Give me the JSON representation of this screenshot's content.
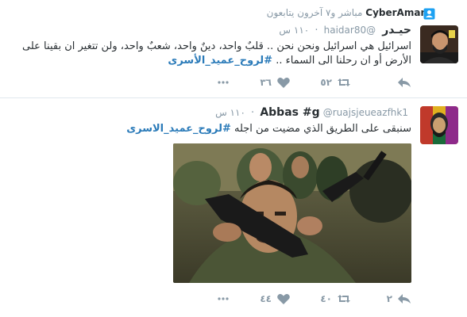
{
  "tweets": [
    {
      "context": {
        "user": "CyberAman",
        "text": "مباشر و٧ آخرون يتابعون"
      },
      "name": "حيـدر",
      "handle": "@haidar80",
      "time": "١١٠ س",
      "text": "اسرائيل هي اسرائيل ونحن نحن .. قلبٌ واحد، دينٌ واحد،  شعبٌ واحد، ولن تتغير ان بقينا على الأرض أو ان رحلنا الى السماء ..",
      "hashtag": "#لروح_عميد_الأسرى",
      "actions": {
        "reply": "",
        "retweet": "٥٢",
        "like": "٣٦"
      },
      "icons": [
        "follow-context-icon",
        "reply-icon",
        "retweet-icon",
        "heart-icon",
        "more-icon"
      ]
    },
    {
      "name": "Abbas #g",
      "handle": "@ruajsjeueazfhk1",
      "time": "١١٠ س",
      "text": "سنبقى على الطريق الذي مضيت من اجله",
      "hashtag": "#لروح_عميد_الاسرى",
      "actions": {
        "reply": "٢",
        "retweet": "٤٠",
        "like": "٤٤"
      }
    }
  ],
  "colors": {
    "accent": "#2b7bb9",
    "muted": "#8899a6",
    "text": "#292f33",
    "follow": "#1da1f2"
  }
}
